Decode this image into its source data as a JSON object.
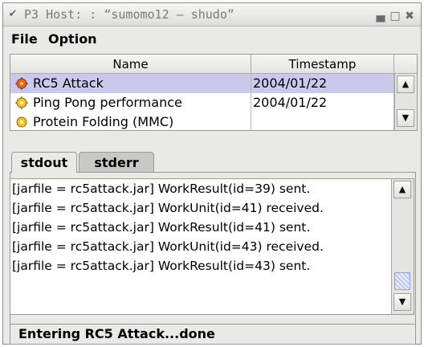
{
  "window": {
    "title": "P3 Host: : “sumomo12 – shudo”",
    "buttons": [
      "minimize",
      "maximize",
      "close"
    ]
  },
  "menubar": {
    "file": "File",
    "option": "Option"
  },
  "table": {
    "columns": [
      "Name",
      "Timestamp"
    ],
    "rows": [
      {
        "name": "RC5 Attack",
        "timestamp": "2004/01/22",
        "icon": "rc5-gear-icon",
        "selected": true
      },
      {
        "name": "Ping Pong performance",
        "timestamp": "2004/01/22",
        "icon": "yellow-gear-icon",
        "selected": false
      },
      {
        "name": "Protein Folding (MMC)",
        "timestamp": "",
        "icon": "yellow-gear-icon",
        "selected": false
      }
    ]
  },
  "tabs": {
    "stdout": "stdout",
    "stderr": "stderr",
    "active": "stdout"
  },
  "log": {
    "lines": [
      "[jarfile = rc5attack.jar] WorkResult(id=39) sent.",
      "[jarfile = rc5attack.jar] WorkUnit(id=41) received.",
      "[jarfile = rc5attack.jar] WorkResult(id=41) sent.",
      "[jarfile = rc5attack.jar] WorkUnit(id=43) received.",
      "[jarfile = rc5attack.jar] WorkResult(id=43) sent."
    ]
  },
  "status": {
    "text": "Entering RC5 Attack...done"
  },
  "colors": {
    "selection": "#c9c9ee",
    "rc5_icon": "#e2651d",
    "gear_icon": "#f2c230"
  }
}
